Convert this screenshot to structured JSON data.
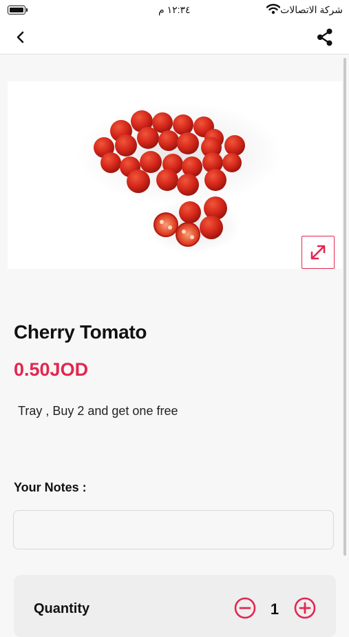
{
  "status_bar": {
    "time": "١٢:٣٤ م",
    "carrier": "شركة الاتصالات",
    "battery_level": 1.0
  },
  "nav": {
    "back_icon": "chevron-left-icon",
    "share_icon": "share-icon"
  },
  "product": {
    "image_alt": "cherry-tomatoes-photo",
    "expand_icon": "expand-arrows-icon",
    "name": "Cherry Tomato",
    "price": "0.50JOD",
    "description": "Tray , Buy 2 and get one free"
  },
  "notes": {
    "label": "Your Notes :",
    "value": "",
    "placeholder": ""
  },
  "quantity": {
    "label": "Quantity",
    "value": "1",
    "decrease_icon": "minus-circle-icon",
    "increase_icon": "plus-circle-icon"
  },
  "colors": {
    "accent": "#e3264f",
    "background": "#f7f7f7",
    "card": "#eeeeee"
  }
}
